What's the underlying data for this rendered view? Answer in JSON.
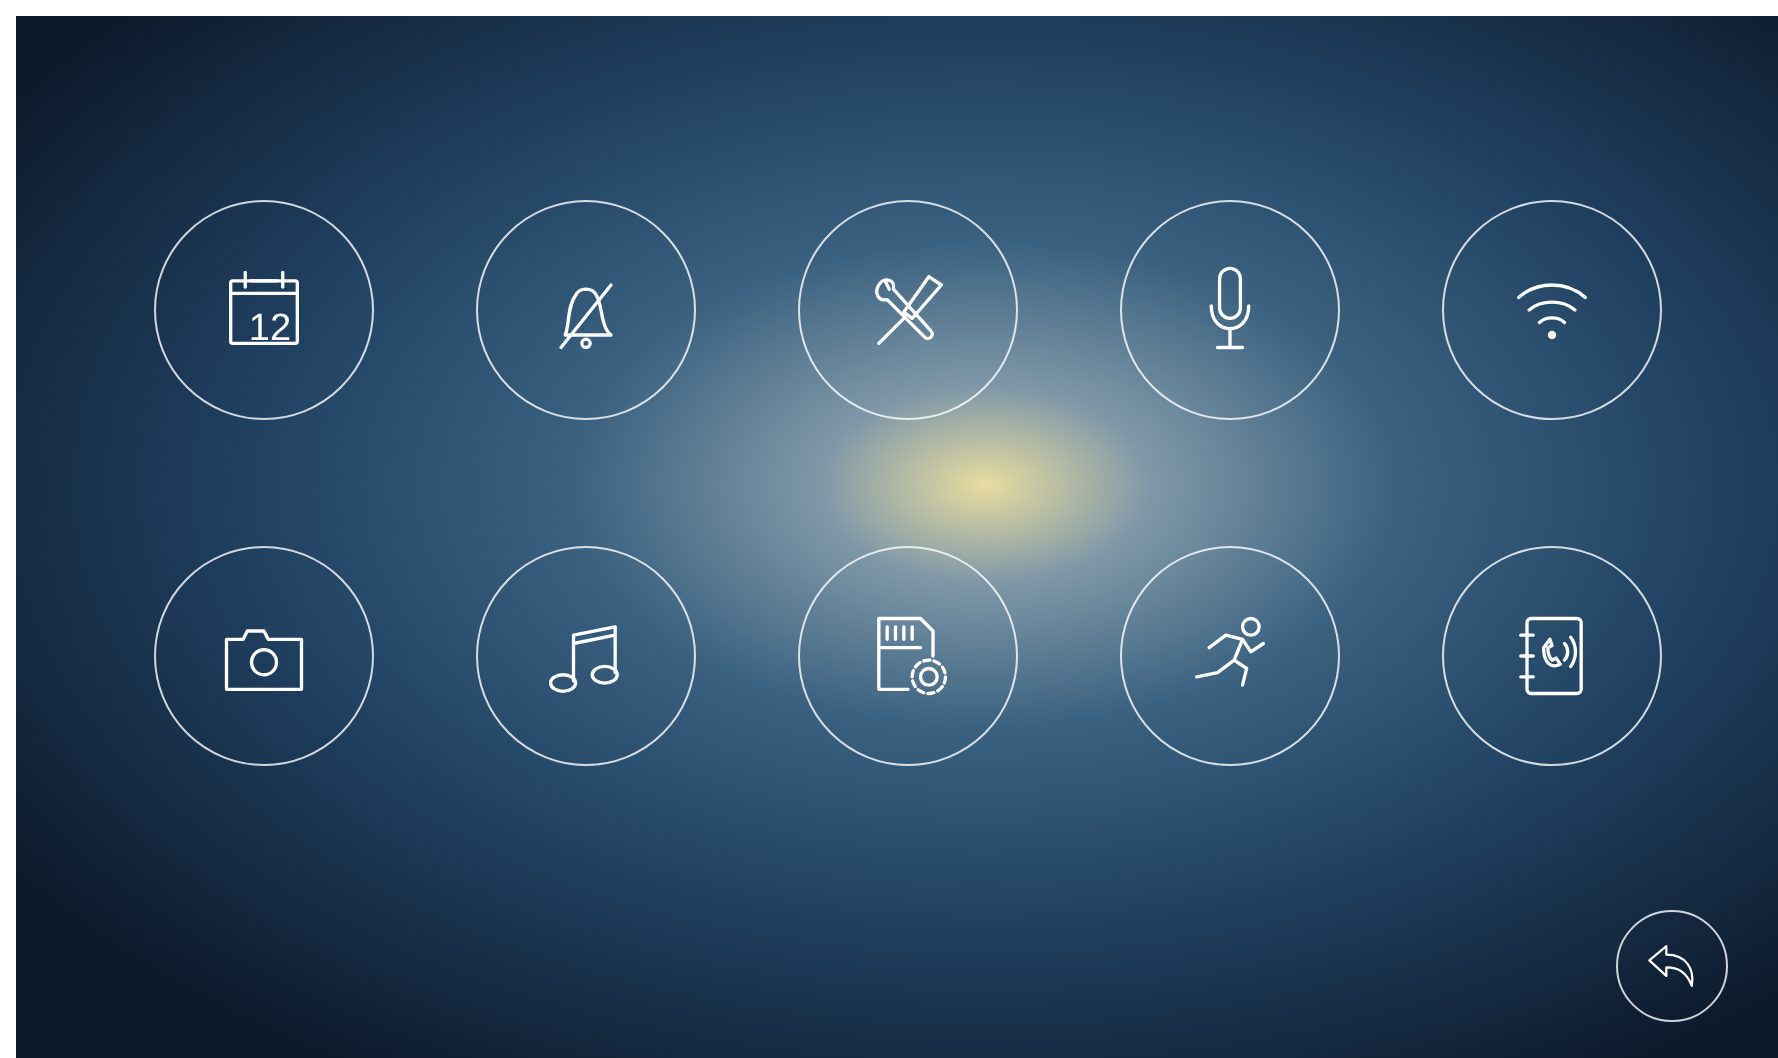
{
  "menu": [
    {
      "kind": "calendar",
      "label": "12"
    },
    {
      "kind": "bell_muted"
    },
    {
      "kind": "tools"
    },
    {
      "kind": "microphone"
    },
    {
      "kind": "wifi"
    },
    {
      "kind": "camera"
    },
    {
      "kind": "music"
    },
    {
      "kind": "sd_settings"
    },
    {
      "kind": "motion"
    },
    {
      "kind": "intercom_book"
    }
  ],
  "back_button": {
    "kind": "back"
  }
}
